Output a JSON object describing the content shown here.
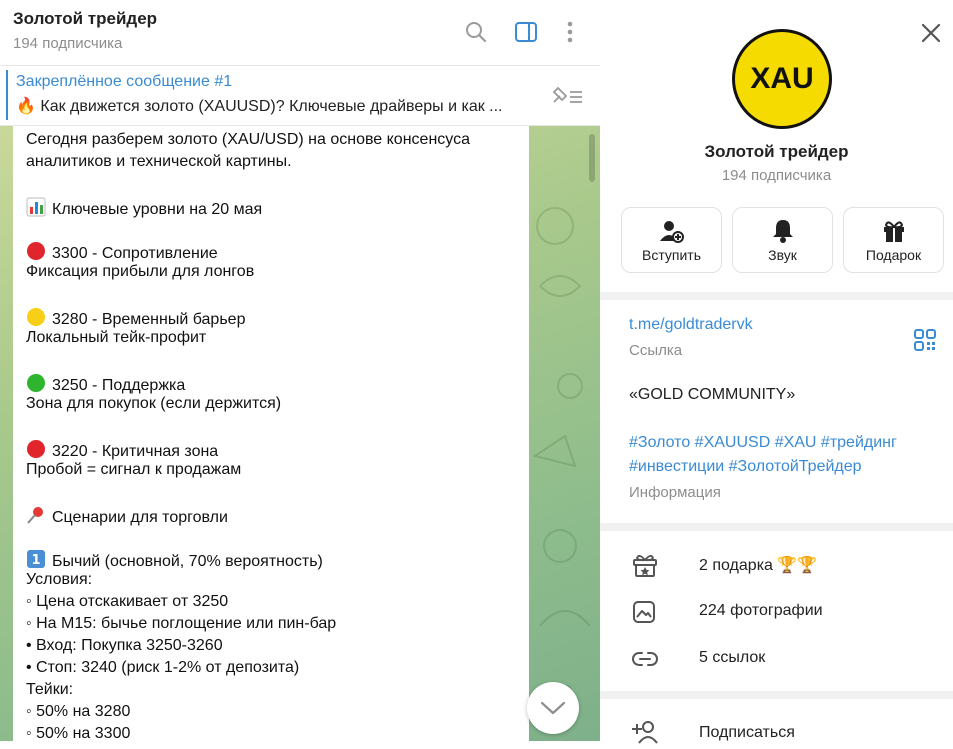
{
  "chat": {
    "title": "Золотой трейдер",
    "subscribers": "194 подписчика",
    "pinned_title": "Закреплённое сообщение #1",
    "pinned_text": "🔥 Как движется золото (XAUUSD)? Ключевые драйверы и как ..."
  },
  "message": {
    "lines": [
      "Сегодня разберем золото (XAU/USD) на основе консенсуса",
      "аналитиков и технической картины.",
      "Ключевые уровни на 20 мая",
      "3300 - Сопротивление",
      "Фиксация прибыли для лонгов",
      "3280 - Временный барьер",
      "Локальный тейк-профит",
      "3250 - Поддержка",
      "Зона для покупок (если держится)",
      "3220 - Критичная зона",
      "Пробой = сигнал к продажам",
      "Сценарии для торговли",
      "Бычий (основной, 70% вероятность)",
      "Условия:",
      "◦ Цена отскакивает от 3250",
      "◦ На M15: бычье поглощение или пин-бар",
      "• Вход: Покупка 3250-3260",
      "• Стоп: 3240 (риск 1-2% от депозита)",
      "Тейки:",
      "◦ 50% на 3280",
      "◦ 50% на 3300"
    ]
  },
  "profile": {
    "avatar_text": "XAU",
    "name": "Золотой трейдер",
    "subscribers": "194 подписчика",
    "actions": [
      "Вступить",
      "Звук",
      "Подарок"
    ],
    "link": "t.me/goldtradervk",
    "link_label": "Ссылка",
    "description": "«GOLD COMMUNITY»",
    "tags_line1": "#Золото #XAUUSD #XAU #трейдинг",
    "tags_line2": "#инвестиции #ЗолотойТрейдер",
    "info_label": "Информация",
    "gifts": "2 подарка 🏆🏆",
    "photos": "224 фотографии",
    "links": "5 ссылок",
    "subscribe": "Подписаться"
  },
  "colors": {
    "accent": "#3a8bd4",
    "avatar_bg": "#f5db00"
  }
}
